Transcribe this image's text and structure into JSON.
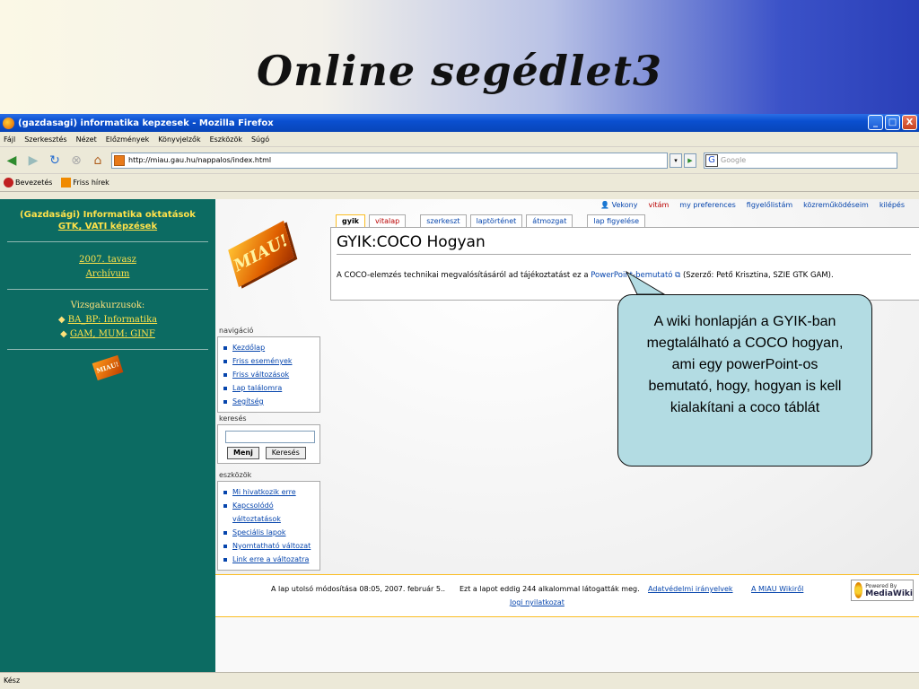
{
  "slide": {
    "title": "Online segédlet3"
  },
  "window": {
    "title": "(gazdasagi) informatika kepzesek - Mozilla Firefox",
    "buttons": {
      "minimize": "_",
      "maximize": "□",
      "close": "X"
    }
  },
  "menu": [
    "Fájl",
    "Szerkesztés",
    "Nézet",
    "Előzmények",
    "Könyvjelzők",
    "Eszközök",
    "Súgó"
  ],
  "nav": {
    "url": "http://miau.gau.hu/nappalos/index.html",
    "search_placeholder": "Google",
    "search_engine": "G"
  },
  "bookmarks": [
    "Bevezetés",
    "Friss hírek"
  ],
  "left_panel": {
    "header": "(Gazdasági) Informatika oktatások",
    "subheader": "GTK, VATI képzések",
    "term": "2007. tavasz",
    "archive": "Archívum",
    "exams_label": "Vizsgakurzusok:",
    "exam_links": [
      "BA_BP: Informatika",
      "GAM, MUM: GINF"
    ],
    "logo_text": "MIAU!"
  },
  "wiki": {
    "logo_text": "MIAU!",
    "user_links": [
      "Vekony",
      "vitám",
      "my preferences",
      "figyelőlistám",
      "közreműködéseim",
      "kilépés"
    ],
    "tabs": [
      "gyik",
      "vitalap",
      "szerkeszt",
      "laptörténet",
      "átmozgat",
      "lap figyelése"
    ],
    "page_title": "GYIK:COCO Hogyan",
    "body_prefix": "A COCO-elemzés technikai megvalósításáról ad tájékoztatást ez a ",
    "body_link": "PowerPoint-bemutató",
    "body_suffix": " (Szerző: Pető Krisztina, SZIE GTK GAM).",
    "navigation": {
      "title": "navigáció",
      "items": [
        "Kezdőlap",
        "Friss események",
        "Friss változások",
        "Lap találomra",
        "Segítség"
      ]
    },
    "search": {
      "title": "keresés",
      "go": "Menj",
      "search": "Keresés"
    },
    "toolbox": {
      "title": "eszközök",
      "items": [
        "Mi hivatkozik erre",
        "Kapcsolódó változtatások",
        "Speciális lapok",
        "Nyomtatható változat",
        "Link erre a változatra"
      ]
    },
    "footer": {
      "last_modified": "A lap utolsó módosítása 08:05, 2007. február 5..",
      "views": "Ezt a lapot eddig 244 alkalommal látogatták meg.",
      "privacy": "Adatvédelmi irányelvek",
      "about": "A MIAU Wikiről",
      "disclaimer": "Jogi nyilatkozat",
      "badge_small": "Powered By",
      "badge_big": "MediaWiki"
    }
  },
  "status": "Kész",
  "callout": "A wiki honlapján a GYIK-ban megtalálható a COCO hogyan, ami egy powerPoint-os bemutató, hogy, hogyan is kell kialakítani a coco táblát"
}
